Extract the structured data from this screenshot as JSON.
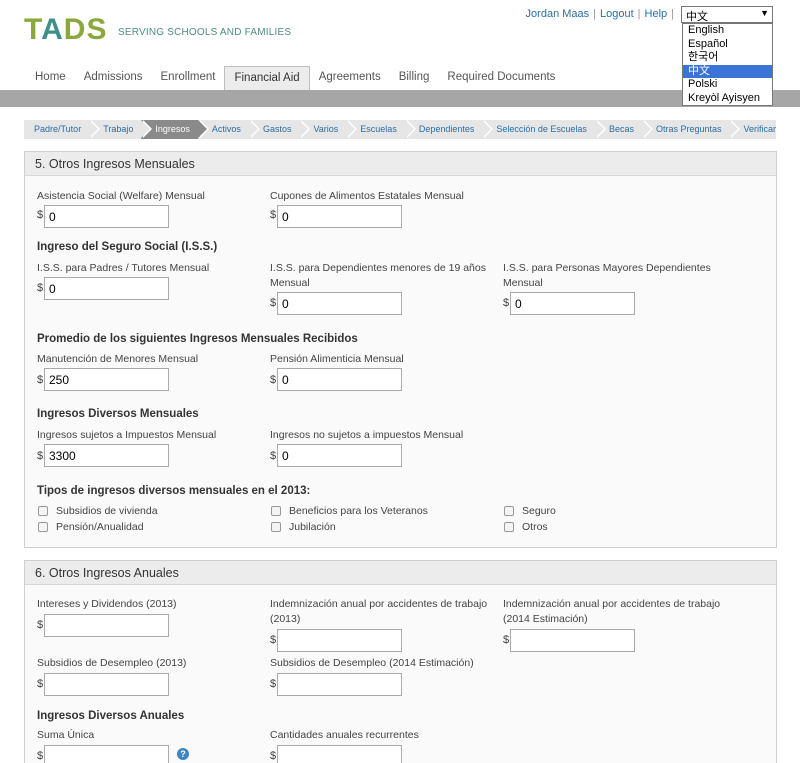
{
  "header": {
    "logo": "TADS",
    "tagline": "SERVING SCHOOLS AND FAMILIES",
    "user": "Jordan Maas",
    "logout": "Logout",
    "help": "Help"
  },
  "language": {
    "selected": "中文",
    "options": [
      "English",
      "Español",
      "한국어",
      "中文",
      "Polski",
      "Kreyòl Ayisyen"
    ]
  },
  "nav": {
    "tabs": [
      "Home",
      "Admissions",
      "Enrollment",
      "Financial Aid",
      "Agreements",
      "Billing",
      "Required Documents"
    ],
    "active": "Financial Aid"
  },
  "steps": [
    "Padre/Tutor",
    "Trabajo",
    "Ingresos",
    "Activos",
    "Gastos",
    "Varios",
    "Escuelas",
    "Dependientes",
    "Selección de Escuelas",
    "Becas",
    "Otras Preguntas",
    "Verificar"
  ],
  "section5": {
    "title": "5. Otros Ingresos Mensuales",
    "welfare_label": "Asistencia Social (Welfare) Mensual",
    "welfare_value": "0",
    "food_label": "Cupones de Alimentos Estatales Mensual",
    "food_value": "0",
    "ss_heading": "Ingreso del Seguro Social (I.S.S.)",
    "ss_parents_label": "I.S.S. para Padres / Tutores Mensual",
    "ss_parents_value": "0",
    "ss_dependents_label": "I.S.S. para Dependientes menores de 19 años Mensual",
    "ss_dependents_value": "0",
    "ss_elders_label": "I.S.S. para Personas Mayores Dependientes Mensual",
    "ss_elders_value": "0",
    "avg_heading": "Promedio de los siguientes Ingresos Mensuales Recibidos",
    "child_support_label": "Manutención de Menores Mensual",
    "child_support_value": "250",
    "alimony_label": "Pensión Alimenticia Mensual",
    "alimony_value": "0",
    "misc_heading": "Ingresos Diversos Mensuales",
    "taxable_label": "Ingresos sujetos a Impuestos Mensual",
    "taxable_value": "3300",
    "nontaxable_label": "Ingresos no sujetos a impuestos Mensual",
    "nontaxable_value": "0",
    "types_heading": "Tipos de ingresos diversos mensuales en el 2013:",
    "types": [
      "Subsidios de vivienda",
      "Beneficios para los Veteranos",
      "Seguro",
      "Pensión/Anualidad",
      "Jubilación",
      "Otros"
    ]
  },
  "section6": {
    "title": "6. Otros Ingresos Anuales",
    "interest_label": "Intereses y Dividendos (2013)",
    "accident2013_label": "Indemnización anual por accidentes de trabajo (2013)",
    "accident2014_label": "Indemnización anual por accidentes de trabajo (2014 Estimación)",
    "unemp2013_label": "Subsidios de Desempleo (2013)",
    "unemp2014_label": "Subsidios de Desempleo (2014 Estimación)",
    "misc_heading": "Ingresos Diversos Anuales",
    "lump_label": "Suma Única",
    "recurring_label": "Cantidades anuales recurrentes"
  },
  "currency": "$",
  "help_glyph": "?"
}
